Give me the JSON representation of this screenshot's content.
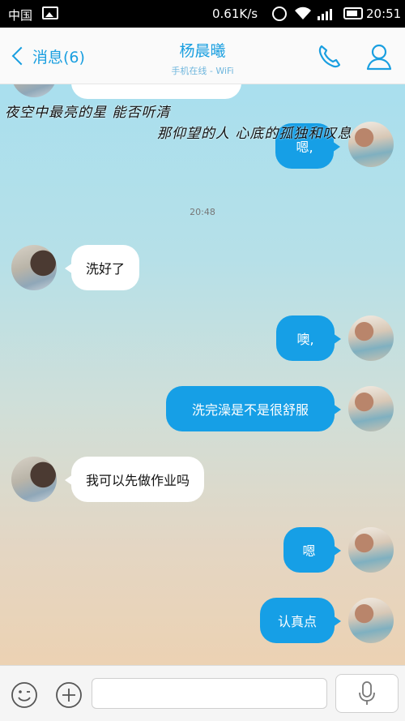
{
  "status_bar": {
    "carrier": "中国",
    "speed": "0.61K/s",
    "time": "20:51",
    "icons": [
      "image-icon",
      "alarm-icon",
      "wifi-icon",
      "signal-icon",
      "battery-icon"
    ]
  },
  "header": {
    "back_label": "消息(6)",
    "contact_name": "杨晨曦",
    "contact_status": "手机在线 - WiFi",
    "icons": [
      "back-chevron-icon",
      "phone-icon",
      "contact-icon"
    ]
  },
  "chat": {
    "lyrics": [
      "夜空中最亮的星 能否听清",
      "那仰望的人 心底的孤独和叹息"
    ],
    "timestamp": "20:48",
    "messages": [
      {
        "side": "out",
        "text": "嗯,"
      },
      {
        "side": "in",
        "text": "洗好了"
      },
      {
        "side": "out",
        "text": "噢,"
      },
      {
        "side": "out",
        "text": "洗完澡是不是很舒服"
      },
      {
        "side": "in",
        "text": "我可以先做作业吗"
      },
      {
        "side": "out",
        "text": "嗯"
      },
      {
        "side": "out",
        "text": "认真点"
      }
    ]
  },
  "input_bar": {
    "placeholder": "",
    "icons": [
      "emoji-icon",
      "add-icon",
      "mic-icon"
    ]
  },
  "colors": {
    "accent": "#1a9fe0",
    "outgoing_bubble": "#169fe6",
    "incoming_bubble": "#ffffff"
  }
}
